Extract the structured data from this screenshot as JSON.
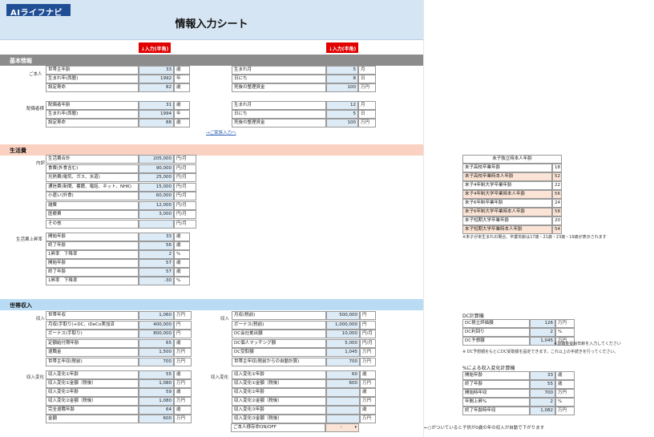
{
  "header": {
    "logo": "AIライフナビ",
    "title": "情報入力シート"
  },
  "input_tag": "↓入力(半角)",
  "sections": {
    "basic": "基本情報",
    "living": "生活費",
    "income": "世帯収入"
  },
  "basic": {
    "self_label": "ご本人",
    "spouse_label": "配偶者様",
    "self_left": [
      {
        "label": "世帯主年齢",
        "value": "33",
        "unit": "歳"
      },
      {
        "label": "生まれ年(西暦)",
        "value": "1992",
        "unit": "年"
      },
      {
        "label": "設定寿命",
        "value": "82",
        "unit": "歳"
      }
    ],
    "self_right": [
      {
        "label": "生まれ月",
        "value": "5",
        "unit": "月"
      },
      {
        "label": "日にち",
        "value": "8",
        "unit": "日"
      },
      {
        "label": "死後の整理資金",
        "value": "100",
        "unit": "万円"
      }
    ],
    "spouse_left": [
      {
        "label": "配偶者年齢",
        "value": "31",
        "unit": "歳"
      },
      {
        "label": "生まれ年(西暦)",
        "value": "1994",
        "unit": "年"
      },
      {
        "label": "設定寿命",
        "value": "88",
        "unit": "歳"
      }
    ],
    "spouse_right": [
      {
        "label": "生まれ月",
        "value": "12",
        "unit": "月"
      },
      {
        "label": "日にち",
        "value": "5",
        "unit": "日"
      },
      {
        "label": "死後の整理資金",
        "value": "100",
        "unit": "万円"
      }
    ],
    "family_link": "→ご家族入力へ"
  },
  "living": {
    "breakdown_label": "内訳",
    "rows": [
      {
        "label": "生活費合計",
        "value": "205,000",
        "unit": "円/月"
      },
      {
        "label": "食費(外食含む)",
        "value": "90,000",
        "unit": "円/月"
      },
      {
        "label": "光熱費(電気、ガス、水道)",
        "value": "25,000",
        "unit": "円/月"
      },
      {
        "label": "通信費(新聞、書籍、電話、ネット、NHK)",
        "value": "15,000",
        "unit": "円/月"
      },
      {
        "label": "小遣い(外食)",
        "value": "60,000",
        "unit": "円/月"
      },
      {
        "label": "雑費",
        "value": "12,000",
        "unit": "円/月"
      },
      {
        "label": "医療費",
        "value": "3,000",
        "unit": "円/月"
      },
      {
        "label": "その他",
        "value": "",
        "unit": "円/月"
      }
    ],
    "reduce_label": "生活費上昇率",
    "reduce_rows": [
      {
        "label": "開始年齢",
        "value": "33",
        "unit": "歳"
      },
      {
        "label": "終了年齢",
        "value": "56",
        "unit": "歳"
      },
      {
        "label": "1昇率　下降率",
        "value": "2",
        "unit": "%"
      },
      {
        "label": "開始年齢",
        "value": "57",
        "unit": "歳"
      },
      {
        "label": "終了年齢",
        "value": "57",
        "unit": "歳"
      },
      {
        "label": "1昇率　下降率",
        "value": "-30",
        "unit": "%"
      }
    ],
    "youngest": {
      "title": "末子独立時本人年齢",
      "rows": [
        {
          "label": "末子高校卒業年齢",
          "value": "18",
          "hl": false
        },
        {
          "label": "末子高校卒業時本人年齢",
          "value": "52",
          "hl": true
        },
        {
          "label": "末子4年制大学卒業年齢",
          "value": "22",
          "hl": false
        },
        {
          "label": "末子4年制大学卒業時本人年齢",
          "value": "56",
          "hl": true
        },
        {
          "label": "末子6年制卒業年齢",
          "value": "24",
          "hl": false
        },
        {
          "label": "末子6年制大学卒業時本人年齢",
          "value": "58",
          "hl": true
        },
        {
          "label": "末子短期大学卒業年齢",
          "value": "20",
          "hl": false
        },
        {
          "label": "末子短期大学卒業時本人年齢",
          "value": "54",
          "hl": true
        }
      ],
      "note": "※末子が未生まれの場合、卒業年齢は17歳・21歳・23歳・19歳が表示されます"
    }
  },
  "income": {
    "income_label": "収入",
    "left": [
      {
        "label": "世帯年収",
        "value": "1,060",
        "unit": "万円"
      },
      {
        "label": "月収(手取り)+DC、iDeCo実加済",
        "value": "400,000",
        "unit": "円"
      },
      {
        "label": "ボーナス(手取り)",
        "value": "800,000",
        "unit": "円"
      },
      {
        "label": "定額給付期年齢",
        "value": "65",
        "unit": "歳"
      },
      {
        "label": "退職金",
        "value": "1,500",
        "unit": "万円"
      },
      {
        "label": "世帯主年収(税前)",
        "value": "700",
        "unit": "万円"
      }
    ],
    "right": [
      {
        "label": "月収(税前)",
        "value": "500,000",
        "unit": "円"
      },
      {
        "label": "ボーナス(税前)",
        "value": "1,000,000",
        "unit": "円"
      },
      {
        "label": "DC会社拠出額",
        "value": "10,000",
        "unit": "円/月"
      },
      {
        "label": "DC個人マッチング額",
        "value": "5,000",
        "unit": "円/月"
      },
      {
        "label": "DC受取額",
        "value": "1,045",
        "unit": "万円"
      },
      {
        "label": "世帯主年収(税前からの自動計算)",
        "value": "700",
        "unit": "万円"
      }
    ],
    "dc": {
      "title": "DC計算機",
      "rows": [
        {
          "label": "DC積立評価額",
          "value": "126",
          "unit": "万円"
        },
        {
          "label": "DC利回り",
          "value": "2",
          "unit": "%"
        },
        {
          "label": "DC予想額",
          "value": "1,045",
          "unit": "万円"
        }
      ],
      "note1": "※退職金受給年齢を入力してください",
      "note2": "※ DC予想額をもとにDC受取額を設定できます。これ以上の手続きを行ってください。"
    },
    "change_label_left": "収入変化",
    "change_label_right": "収入変化",
    "change_left": [
      {
        "label": "収入変化①年齢",
        "value": "55",
        "unit": "歳"
      },
      {
        "label": "収入変化①金額（税後）",
        "value": "1,080",
        "unit": "万円"
      },
      {
        "label": "収入変化②年齢",
        "value": "59",
        "unit": "歳"
      },
      {
        "label": "収入変化②金額（税後）",
        "value": "1,080",
        "unit": "万円"
      },
      {
        "label": "完全退職年齢",
        "value": "64",
        "unit": "歳"
      },
      {
        "label": "金額",
        "value": "600",
        "unit": "万円"
      }
    ],
    "change_right": [
      {
        "label": "収入変化①年齢",
        "value": "60",
        "unit": "歳"
      },
      {
        "label": "収入変化①金額（税後）",
        "value": "600",
        "unit": "万円"
      },
      {
        "label": "収入変化②年齢",
        "value": "",
        "unit": "歳"
      },
      {
        "label": "収入変化②金額（税後）",
        "value": "",
        "unit": "万円"
      },
      {
        "label": "収入変化③年齢",
        "value": "",
        "unit": "歳"
      },
      {
        "label": "収入変化③金額（税後）",
        "value": "",
        "unit": "万円"
      }
    ],
    "onoff_label": "ご本人様存命ON/OFF",
    "onoff_value": "-",
    "pct": {
      "title": "%による収入変化計算機",
      "rows": [
        {
          "label": "開始年齢",
          "value": "33",
          "unit": "歳"
        },
        {
          "label": "終了年齢",
          "value": "55",
          "unit": "歳"
        },
        {
          "label": "開始時年収",
          "value": "700",
          "unit": "万円"
        },
        {
          "label": "年間上昇%",
          "value": "2",
          "unit": "%"
        },
        {
          "label": "終了年齢時年収",
          "value": "1,082",
          "unit": "万円"
        }
      ]
    },
    "bottom_note": "←○がついていると子供が0歳の年の収入が自動で下がります"
  },
  "colors": {
    "band_gray": "#8c8c8c",
    "band_pink": "#fbd2c2",
    "band_blue": "#b9dcf4",
    "input_blue": "#ddebf7",
    "highlight": "#fbe4d5",
    "red": "#e00000"
  }
}
